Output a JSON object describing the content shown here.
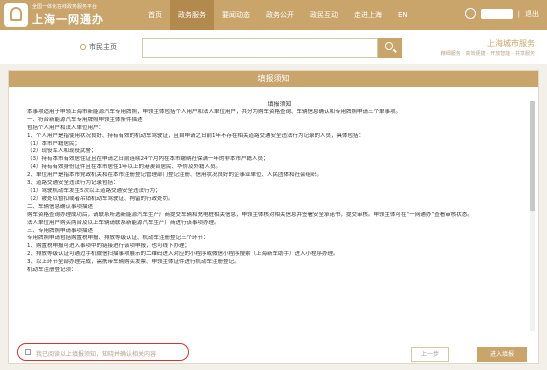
{
  "brand": {
    "subtitle": "全国一体化在线政务服务平台",
    "title": "上海一网通办"
  },
  "nav": {
    "items": [
      {
        "label": "首页"
      },
      {
        "label": "政务服务"
      },
      {
        "label": "要闻动态"
      },
      {
        "label": "政务公开"
      },
      {
        "label": "政民互动"
      },
      {
        "label": "走进上海"
      },
      {
        "label": "EN"
      }
    ],
    "logout_label": "退出"
  },
  "subbar": {
    "home_label": "市民主页",
    "search_value": "",
    "slogan_title": "上海城市服务",
    "slogan_sub": "精细服务 · 高效便捷 · 开放智能 · 共享服务"
  },
  "panel": {
    "header": "填报须知",
    "doc_title": "填报须知",
    "lines": [
      "本事项适用于申领上海市新能源汽车专用牌照，申领主体包括个人用户和法人单位用户，共分为购车资格查询、车辆信息确认和专用牌照申请三个单事项。",
      "一、符合新能源汽车专用牌照申领主体条件描述",
      "包括个人用户和法人单位用户：",
      "1、个人用户是指使用状况良好、持有有效的机动车驾驶证，且自申请之日前1年不存在相关道路交通安全违法行为记录的人员，具体包括：",
      "（1）本市户籍居民；",
      "（2）现役军人和现役武警；",
      "（3）持有本市有效居住证且在申请之日前连续24个月内在本市缴纳社保满一年的非本市户籍人员；",
      "（4）持有有效身份证件且在本市居住1年以上的港澳台居民、华侨及外籍人员。",
      "2、单位用户是指本市党政机关和在本市注册登记管理部门登记注册、信用状况良好的企事业单位、人民团体和社会组织。",
      "3、道路交通安全违法行为记录包括：",
      "（1）驾驶机动车发生5次以上道路交通安全违法行为；",
      "（2）被处以暂扣或者吊销机动车驾驶证、拘留的行政处罚。",
      "二、车辆信息确认事项描述",
      "购车资格查询办理成功后，请联系所选新能源汽车生产厂商提交车辆和充电桩相关信息，申领主体核对相关信息并签署安全承诺书，提交审核。申领主体可在“一网通办”查看审核状态。",
      "法人单位用户购买两台及以上车辆请联系新能源汽车生产厂商进行该事项办理。",
      "三、专用牌照申请事项描述",
      "专用牌照申请包括购置税申报、排放等级认证、机动车注册登记三个环节：",
      "1、购置税申报可进入事项中的链接进行该项申报，也可线下办理；",
      "2、排放等级认证可通过手机微信扫描事项展示的二维码进入对应的小程序或微信小程序搜索（上海新车助手）进入小程序办理。",
      "3、以上环节全部办理完成，需携带车辆购买发票、申领主体证件进行机动车注册登记。",
      "机动车注册登记须："
    ],
    "agree_label": "我已阅读以上填报须知，知晓并确认相关内容",
    "prev_label": "上一步",
    "next_label": "进入填报"
  }
}
